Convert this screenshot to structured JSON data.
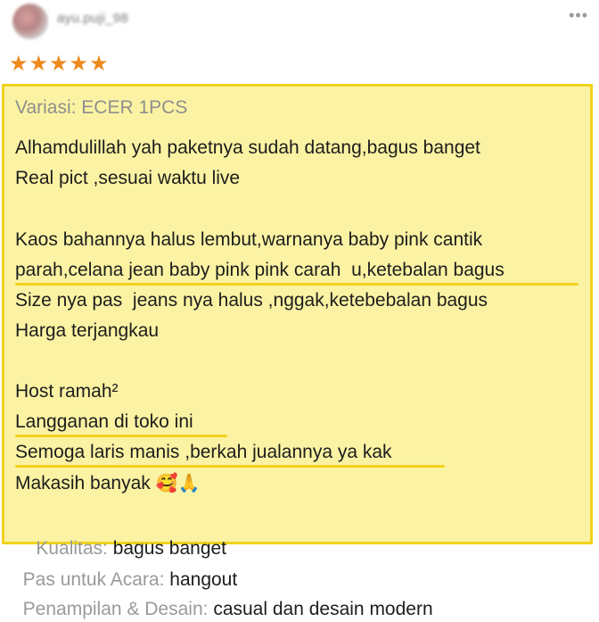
{
  "header": {
    "username": "ayu.puji_98",
    "more_glyph": "•••"
  },
  "rating": {
    "stars": 5,
    "max": 5,
    "star_glyph": "★",
    "color": "#ee8a1e"
  },
  "review": {
    "variation": "Variasi: ECER 1PCS",
    "lines": [
      "Alhamdulillah yah paketnya sudah datang,bagus banget",
      "Real pict ,sesuai waktu live",
      "Kaos bahannya halus lembut,warnanya baby pink cantik",
      "parah,celana jean baby pink pink carah  u,ketebalan bagus",
      "Size nya pas  jeans nya halus ,nggak,ketebebalan bagus",
      "Harga terjangkau",
      "Host ramah²",
      "Langganan di toko ini",
      "Semoga laris manis ,berkah jualannya ya kak",
      "Makasih banyak"
    ],
    "emojis": "🥰🙏"
  },
  "attributes": [
    {
      "label": "Kualitas:",
      "value": "bagus banget"
    },
    {
      "label": "Pas untuk Acara:",
      "value": "hangout"
    },
    {
      "label": "Penampilan & Desain:",
      "value": "casual dan desain modern"
    }
  ],
  "colors": {
    "highlight_bg": "#fbf3a3",
    "highlight_border": "#f0d31b"
  }
}
